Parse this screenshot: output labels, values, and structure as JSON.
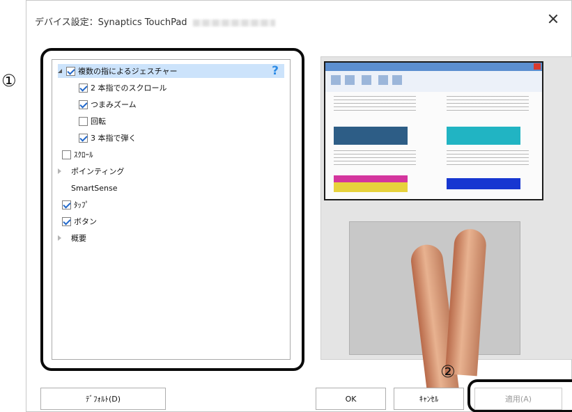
{
  "callouts": {
    "one": "①",
    "two": "②"
  },
  "dialog": {
    "title": "デバイス設定：Synaptics TouchPad",
    "close_glyph": "×"
  },
  "tree": {
    "help_glyph": "?",
    "items": [
      {
        "label": "複数の指によるジェスチャー",
        "checked": true,
        "expander": "expanded",
        "selected": true
      },
      {
        "label": "2 本指でのスクロール",
        "checked": true
      },
      {
        "label": "つまみズーム",
        "checked": true
      },
      {
        "label": "回転",
        "checked": false
      },
      {
        "label": "3 本指で弾く",
        "checked": true
      },
      {
        "label": "ｽｸﾛｰﾙ",
        "checked": false
      },
      {
        "label": "ポインティング",
        "expander": "collapsed"
      },
      {
        "label": "SmartSense"
      },
      {
        "label": "ﾀｯﾌﾟ",
        "checked": true
      },
      {
        "label": "ボタン",
        "checked": true
      },
      {
        "label": "概要",
        "expander": "collapsed"
      }
    ]
  },
  "preview": {
    "icons": [
      "preview-screen-icon",
      "two-finger-gesture-icon"
    ]
  },
  "buttons": {
    "default": "ﾃﾞﾌｫﾙﾄ(D)",
    "ok": "OK",
    "cancel": "ｷｬﾝｾﾙ",
    "apply": "適用(A)"
  },
  "colors": {
    "selection": "#cce3fb",
    "checkmark": "#2268c9",
    "help": "#2e8ce6",
    "callout_frame": "#0b0b0b"
  }
}
